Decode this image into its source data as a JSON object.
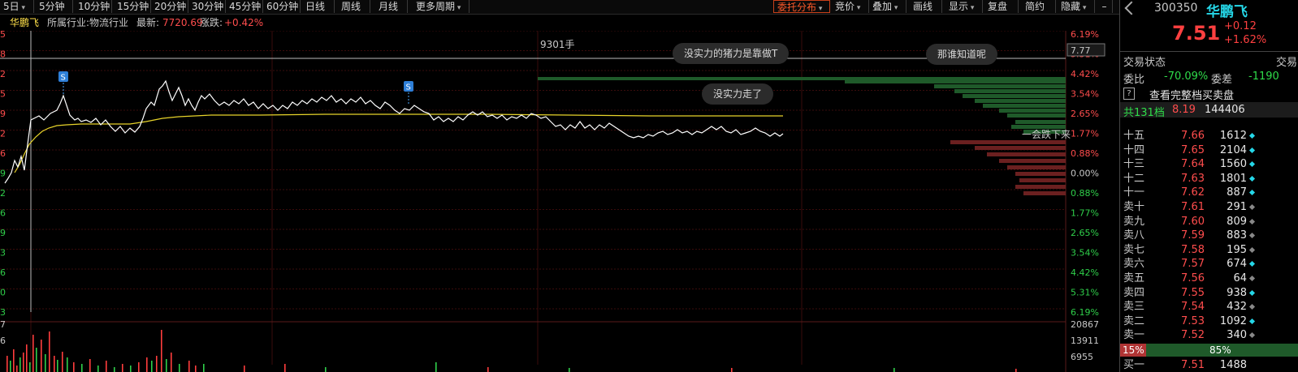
{
  "toolbar": {
    "period_selector": "5日",
    "periods": [
      "5分钟",
      "10分钟",
      "15分钟",
      "20分钟",
      "30分钟",
      "45分钟",
      "60分钟",
      "日线",
      "周线",
      "月线",
      "更多周期"
    ],
    "right_menus": [
      "委托分布",
      "竞价",
      "叠加",
      "画线",
      "显示",
      "复盘",
      "简约",
      "隐藏"
    ],
    "minimize_icon": "minimize-icon",
    "close_icon": "close-icon"
  },
  "info": {
    "stock_name": "华鹏飞",
    "industry_label": "所属行业:",
    "industry": "物流行业",
    "latest_label": "最新:",
    "latest": "7720.69",
    "change_label": "涨跌:",
    "change": "+0.42%"
  },
  "chart": {
    "volume_marker": "9301手",
    "right_axis_labels": [
      "6.19%",
      "5.31%",
      "4.42%",
      "3.54%",
      "2.65%",
      "1.77%",
      "0.88%",
      "0.00%",
      "0.88%",
      "1.77%",
      "2.65%",
      "3.54%",
      "4.42%",
      "5.31%",
      "6.19%"
    ],
    "price_box": "7.77",
    "left_axis_fragments": [
      "5",
      "8",
      "2",
      "5",
      "9",
      "2",
      "6",
      "9",
      "2",
      "6",
      "9",
      "3",
      "6",
      "0",
      "3"
    ],
    "volume_axis_labels": [
      "20867",
      "13911",
      "6955"
    ],
    "volume_left_fragments": [
      "7",
      "6"
    ],
    "sell_markers": [
      "S",
      "S"
    ],
    "comments": [
      "没实力的猪力是靠做T",
      "那谁知道呢",
      "没实力走了",
      "一会跌下来"
    ],
    "colors": {
      "price_line": "#ffffff",
      "avg_line": "#e8d42a",
      "up": "#ff3d3d",
      "down": "#2fcf4a",
      "grid": "#3a0b0b"
    }
  },
  "panel": {
    "code": "300350",
    "name": "华鹏飞",
    "price": "7.51",
    "change": "+0.12",
    "change_pct": "+1.62%",
    "status_label": "交易状态",
    "status_value": "交易",
    "ratio_label": "委比",
    "ratio_value": "-70.09%",
    "diff_label": "委差",
    "diff_value": "-1190",
    "help_icon": "?",
    "full_book_label": "查看完整档买卖盘",
    "total_label": "共131档",
    "total_price": "8.19",
    "total_vol": "144406",
    "levels": [
      {
        "name": "十五",
        "price": "7.66",
        "vol": "1612",
        "dot": "cyan"
      },
      {
        "name": "十四",
        "price": "7.65",
        "vol": "2104",
        "dot": "cyan"
      },
      {
        "name": "十三",
        "price": "7.64",
        "vol": "1560",
        "dot": "cyan"
      },
      {
        "name": "十二",
        "price": "7.63",
        "vol": "1801",
        "dot": "cyan"
      },
      {
        "name": "十一",
        "price": "7.62",
        "vol": "887",
        "dot": "cyan"
      },
      {
        "name": "卖十",
        "price": "7.61",
        "vol": "291",
        "dot": "gray"
      },
      {
        "name": "卖九",
        "price": "7.60",
        "vol": "809",
        "dot": "gray"
      },
      {
        "name": "卖八",
        "price": "7.59",
        "vol": "883",
        "dot": "gray"
      },
      {
        "name": "卖七",
        "price": "7.58",
        "vol": "195",
        "dot": "gray"
      },
      {
        "name": "卖六",
        "price": "7.57",
        "vol": "674",
        "dot": "cyan"
      },
      {
        "name": "卖五",
        "price": "7.56",
        "vol": "64",
        "dot": "gray"
      },
      {
        "name": "卖四",
        "price": "7.55",
        "vol": "938",
        "dot": "cyan"
      },
      {
        "name": "卖三",
        "price": "7.54",
        "vol": "432",
        "dot": "gray"
      },
      {
        "name": "卖二",
        "price": "7.53",
        "vol": "1092",
        "dot": "cyan"
      },
      {
        "name": "卖一",
        "price": "7.52",
        "vol": "340",
        "dot": "gray"
      }
    ],
    "bar_left_pct": "15%",
    "bar_right_pct": "85%",
    "buy1_name": "买一",
    "buy1_price": "7.51",
    "buy1_vol": "1488"
  }
}
